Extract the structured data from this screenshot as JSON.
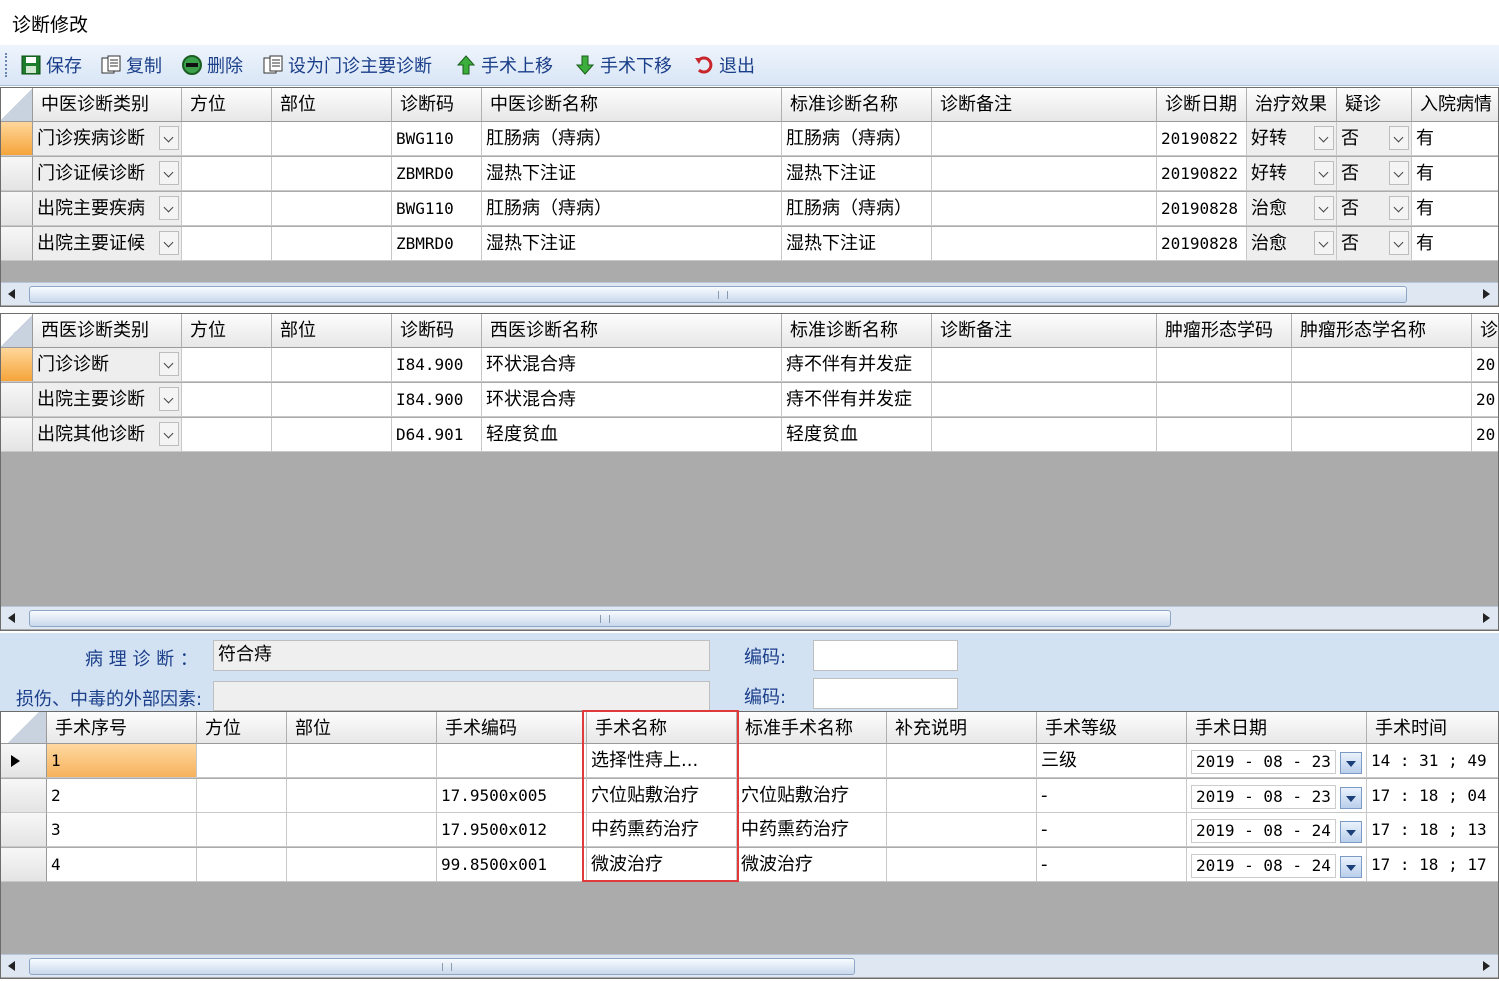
{
  "window": {
    "title": "诊断修改"
  },
  "toolbar": {
    "save": "保存",
    "copy": "复制",
    "delete": "删除",
    "set_main": "设为门诊主要诊断",
    "move_up": "手术上移",
    "move_down": "手术下移",
    "exit": "退出"
  },
  "tcm_grid": {
    "headers": [
      "中医诊断类别",
      "方位",
      "部位",
      "诊断码",
      "中医诊断名称",
      "标准诊断名称",
      "诊断备注",
      "诊断日期",
      "治疗效果",
      "疑诊",
      "入院病情"
    ],
    "rows": [
      {
        "category": "门诊疾病诊断",
        "direction": "",
        "site": "",
        "code": "BWG110",
        "name": "肛肠病（痔病）",
        "std_name": "肛肠病（痔病）",
        "remark": "",
        "date": "20190822",
        "effect": "好转",
        "suspect": "否",
        "admission": "有"
      },
      {
        "category": "门诊证候诊断",
        "direction": "",
        "site": "",
        "code": "ZBMRD0",
        "name": "湿热下注证",
        "std_name": "湿热下注证",
        "remark": "",
        "date": "20190822",
        "effect": "好转",
        "suspect": "否",
        "admission": "有"
      },
      {
        "category": "出院主要疾病",
        "direction": "",
        "site": "",
        "code": "BWG110",
        "name": "肛肠病（痔病）",
        "std_name": "肛肠病（痔病）",
        "remark": "",
        "date": "20190828",
        "effect": "治愈",
        "suspect": "否",
        "admission": "有"
      },
      {
        "category": "出院主要证候",
        "direction": "",
        "site": "",
        "code": "ZBMRD0",
        "name": "湿热下注证",
        "std_name": "湿热下注证",
        "remark": "",
        "date": "20190828",
        "effect": "治愈",
        "suspect": "否",
        "admission": "有"
      }
    ]
  },
  "wm_grid": {
    "headers": [
      "西医诊断类别",
      "方位",
      "部位",
      "诊断码",
      "西医诊断名称",
      "标准诊断名称",
      "诊断备注",
      "肿瘤形态学码",
      "肿瘤形态学名称",
      "诊"
    ],
    "rows": [
      {
        "category": "门诊诊断",
        "direction": "",
        "site": "",
        "code": "I84.900",
        "name": "环状混合痔",
        "std_name": "痔不伴有并发症",
        "remark": "",
        "morph_code": "",
        "morph_name": "",
        "date_partial": "20"
      },
      {
        "category": "出院主要诊断",
        "direction": "",
        "site": "",
        "code": "I84.900",
        "name": "环状混合痔",
        "std_name": "痔不伴有并发症",
        "remark": "",
        "morph_code": "",
        "morph_name": "",
        "date_partial": "20"
      },
      {
        "category": "出院其他诊断",
        "direction": "",
        "site": "",
        "code": "D64.901",
        "name": "轻度贫血",
        "std_name": "轻度贫血",
        "remark": "",
        "morph_code": "",
        "morph_name": "",
        "date_partial": "20"
      }
    ]
  },
  "pathology": {
    "label": "病 理 诊 断 ：",
    "value": "符合痔",
    "code_label": "编码:",
    "code_value": "",
    "injury_label": "损伤、中毒的外部因素:",
    "injury_value": "",
    "injury_code_label": "编码:",
    "injury_code_value": ""
  },
  "surgery_grid": {
    "headers": [
      "手术序号",
      "方位",
      "部位",
      "手术编码",
      "手术名称",
      "标准手术名称",
      "补充说明",
      "手术等级",
      "手术日期",
      "手术时间"
    ],
    "rows": [
      {
        "seq": "1",
        "direction": "",
        "site": "",
        "code": "",
        "name": "选择性痔上...",
        "std_name": "",
        "note": "",
        "level": "三级",
        "date": "2019 - 08 - 23",
        "time": "14 : 31 ; 49"
      },
      {
        "seq": "2",
        "direction": "",
        "site": "",
        "code": "17.9500x005",
        "name": "穴位贴敷治疗",
        "std_name": "穴位贴敷治疗",
        "note": "",
        "level": "-",
        "date": "2019 - 08 - 23",
        "time": "17 : 18 ; 04"
      },
      {
        "seq": "3",
        "direction": "",
        "site": "",
        "code": "17.9500x012",
        "name": "中药熏药治疗",
        "std_name": "中药熏药治疗",
        "note": "",
        "level": "-",
        "date": "2019 - 08 - 24",
        "time": "17 : 18 ; 13"
      },
      {
        "seq": "4",
        "direction": "",
        "site": "",
        "code": "99.8500x001",
        "name": "微波治疗",
        "std_name": "微波治疗",
        "note": "",
        "level": "-",
        "date": "2019 - 08 - 24",
        "time": "17 : 18 ; 17"
      }
    ]
  },
  "icons": [
    "save-icon",
    "copy-icon",
    "delete-icon",
    "set-main-icon",
    "arrow-up-icon",
    "arrow-down-icon",
    "exit-icon"
  ],
  "colors": {
    "toolbar_text": "#1a3e8a",
    "current_row": "#f5a43a",
    "highlight_box": "#e03a3a",
    "grid_bg": "#ababab"
  }
}
